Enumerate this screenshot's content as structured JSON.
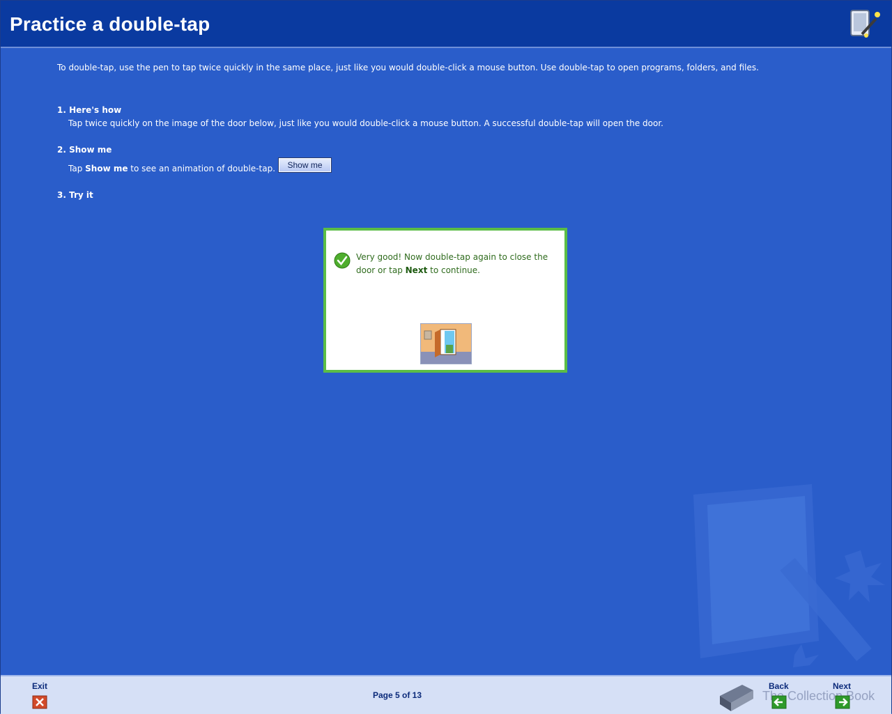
{
  "header": {
    "title": "Practice a double-tap",
    "icon": "tablet-pen-icon"
  },
  "intro": "To double-tap, use the pen to tap twice quickly in the same place, just like you would double-click a mouse button. Use double-tap to open programs, folders, and files.",
  "steps": [
    {
      "title": "1. Here's how",
      "text": "Tap twice quickly on the image of the door below, just like you would double-click a mouse button. A successful double-tap will open the door."
    },
    {
      "title": "2. Show me",
      "text_prefix": "Tap ",
      "text_bold": "Show me",
      "text_suffix": " to see an animation of double-tap.",
      "button_label": "Show me"
    },
    {
      "title": "3. Try it"
    }
  ],
  "panel": {
    "message_prefix": "Very good! Now double-tap again to close the door or tap ",
    "message_bold": "Next",
    "message_suffix": " to continue.",
    "icon": "checkmark-icon",
    "image": "open-door-image"
  },
  "footer": {
    "exit_label": "Exit",
    "back_label": "Back",
    "next_label": "Next",
    "page_text": "Page 5 of 13",
    "watermark": "The Collection Book"
  },
  "colors": {
    "background": "#2a5dca",
    "header": "#0a3aa0",
    "panel_border": "#5bbd46",
    "footer": "#d6e0f6"
  }
}
